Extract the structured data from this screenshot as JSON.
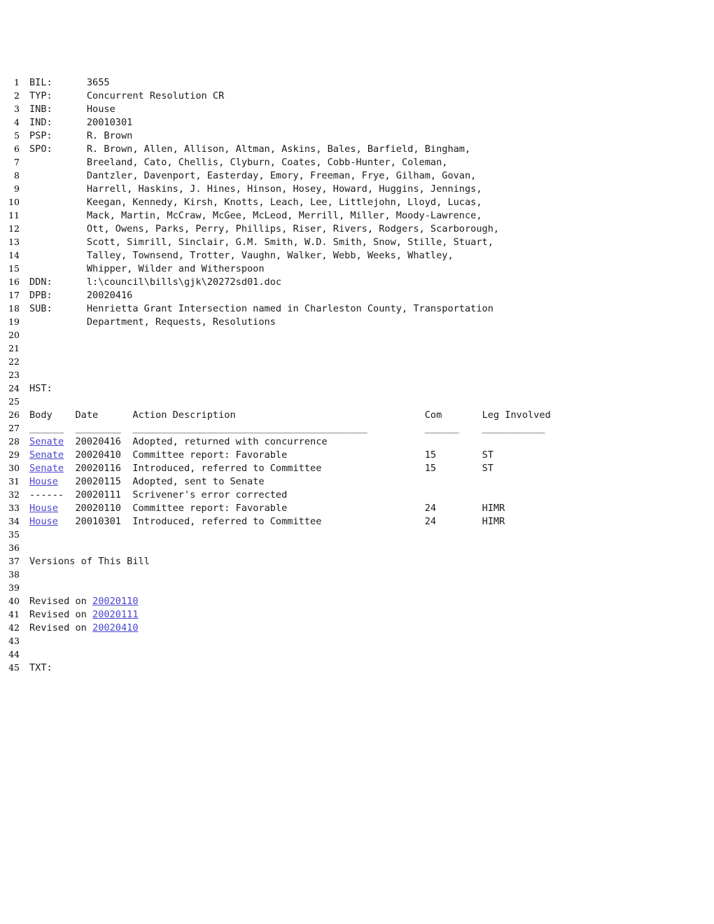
{
  "document": {
    "type": "legislative-bill-record",
    "fields": [
      {
        "line": 1,
        "label": "BIL:",
        "value": "3655"
      },
      {
        "line": 2,
        "label": "TYP:",
        "value": "Concurrent Resolution CR"
      },
      {
        "line": 3,
        "label": "INB:",
        "value": "House"
      },
      {
        "line": 4,
        "label": "IND:",
        "value": "20010301"
      },
      {
        "line": 5,
        "label": "PSP:",
        "value": "R. Brown"
      },
      {
        "line": 6,
        "label": "SPO:",
        "value": "R. Brown, Allen, Allison, Altman, Askins, Bales, Barfield, Bingham,"
      },
      {
        "line": 7,
        "label": "",
        "value": "Breeland, Cato, Chellis, Clyburn, Coates, Cobb-Hunter, Coleman,"
      },
      {
        "line": 8,
        "label": "",
        "value": "Dantzler, Davenport, Easterday, Emory, Freeman, Frye, Gilham, Govan,"
      },
      {
        "line": 9,
        "label": "",
        "value": "Harrell, Haskins, J. Hines, Hinson, Hosey, Howard, Huggins, Jennings,"
      },
      {
        "line": 10,
        "label": "",
        "value": "Keegan, Kennedy, Kirsh, Knotts, Leach, Lee, Littlejohn, Lloyd, Lucas,"
      },
      {
        "line": 11,
        "label": "",
        "value": "Mack, Martin, McCraw, McGee, McLeod, Merrill, Miller, Moody-Lawrence,"
      },
      {
        "line": 12,
        "label": "",
        "value": "Ott, Owens, Parks, Perry, Phillips, Riser, Rivers, Rodgers, Scarborough,"
      },
      {
        "line": 13,
        "label": "",
        "value": "Scott, Simrill, Sinclair, G.M. Smith, W.D. Smith, Snow, Stille, Stuart,"
      },
      {
        "line": 14,
        "label": "",
        "value": "Talley, Townsend, Trotter, Vaughn, Walker, Webb, Weeks, Whatley,"
      },
      {
        "line": 15,
        "label": "",
        "value": "Whipper, Wilder and Witherspoon"
      },
      {
        "line": 16,
        "label": "DDN:",
        "value": "l:\\council\\bills\\gjk\\20272sd01.doc"
      },
      {
        "line": 17,
        "label": "DPB:",
        "value": "20020416"
      },
      {
        "line": 18,
        "label": "SUB:",
        "value": "Henrietta Grant Intersection named in Charleston County, Transportation"
      },
      {
        "line": 19,
        "label": "",
        "value": "Department, Requests, Resolutions"
      }
    ],
    "history_label": "HST:",
    "history_label_line": 24,
    "history_header_line": 26,
    "history_rule_line": 27,
    "history_header": {
      "body": "Body",
      "date": "Date",
      "action": "Action Description",
      "com": "Com",
      "leg": "Leg Involved"
    },
    "history_rules": {
      "body": "______",
      "date": "________",
      "action": "_________________________________________",
      "com": "______",
      "leg": "___________"
    },
    "history_rows": [
      {
        "line": 28,
        "body": "Senate",
        "body_link": true,
        "date": "20020416",
        "action": "Adopted, returned with concurrence",
        "com": "",
        "leg": ""
      },
      {
        "line": 29,
        "body": "Senate",
        "body_link": true,
        "date": "20020410",
        "action": "Committee report: Favorable",
        "com": "15",
        "leg": "ST"
      },
      {
        "line": 30,
        "body": "Senate",
        "body_link": true,
        "date": "20020116",
        "action": "Introduced, referred to Committee",
        "com": "15",
        "leg": "ST"
      },
      {
        "line": 31,
        "body": "House",
        "body_link": true,
        "date": "20020115",
        "action": "Adopted, sent to Senate",
        "com": "",
        "leg": ""
      },
      {
        "line": 32,
        "body": "------",
        "body_link": false,
        "date": "20020111",
        "action": "Scrivener's error corrected",
        "com": "",
        "leg": ""
      },
      {
        "line": 33,
        "body": "House",
        "body_link": true,
        "date": "20020110",
        "action": "Committee report: Favorable",
        "com": "24",
        "leg": "HIMR"
      },
      {
        "line": 34,
        "body": "House",
        "body_link": true,
        "date": "20010301",
        "action": "Introduced, referred to Committee",
        "com": "24",
        "leg": "HIMR"
      }
    ],
    "versions_heading": "Versions of This Bill",
    "versions_heading_line": 37,
    "versions": [
      {
        "line": 40,
        "prefix": "Revised on ",
        "date": "20020110"
      },
      {
        "line": 41,
        "prefix": "Revised on ",
        "date": "20020111"
      },
      {
        "line": 42,
        "prefix": "Revised on ",
        "date": "20020410"
      }
    ],
    "txt_label": "TXT:",
    "txt_label_line": 45,
    "blank_lines": [
      20,
      21,
      22,
      23,
      25,
      35,
      36,
      38,
      39,
      43,
      44
    ],
    "total_lines": 45,
    "link_color": "#4b45cf",
    "text_color": "#1a1a1a"
  }
}
